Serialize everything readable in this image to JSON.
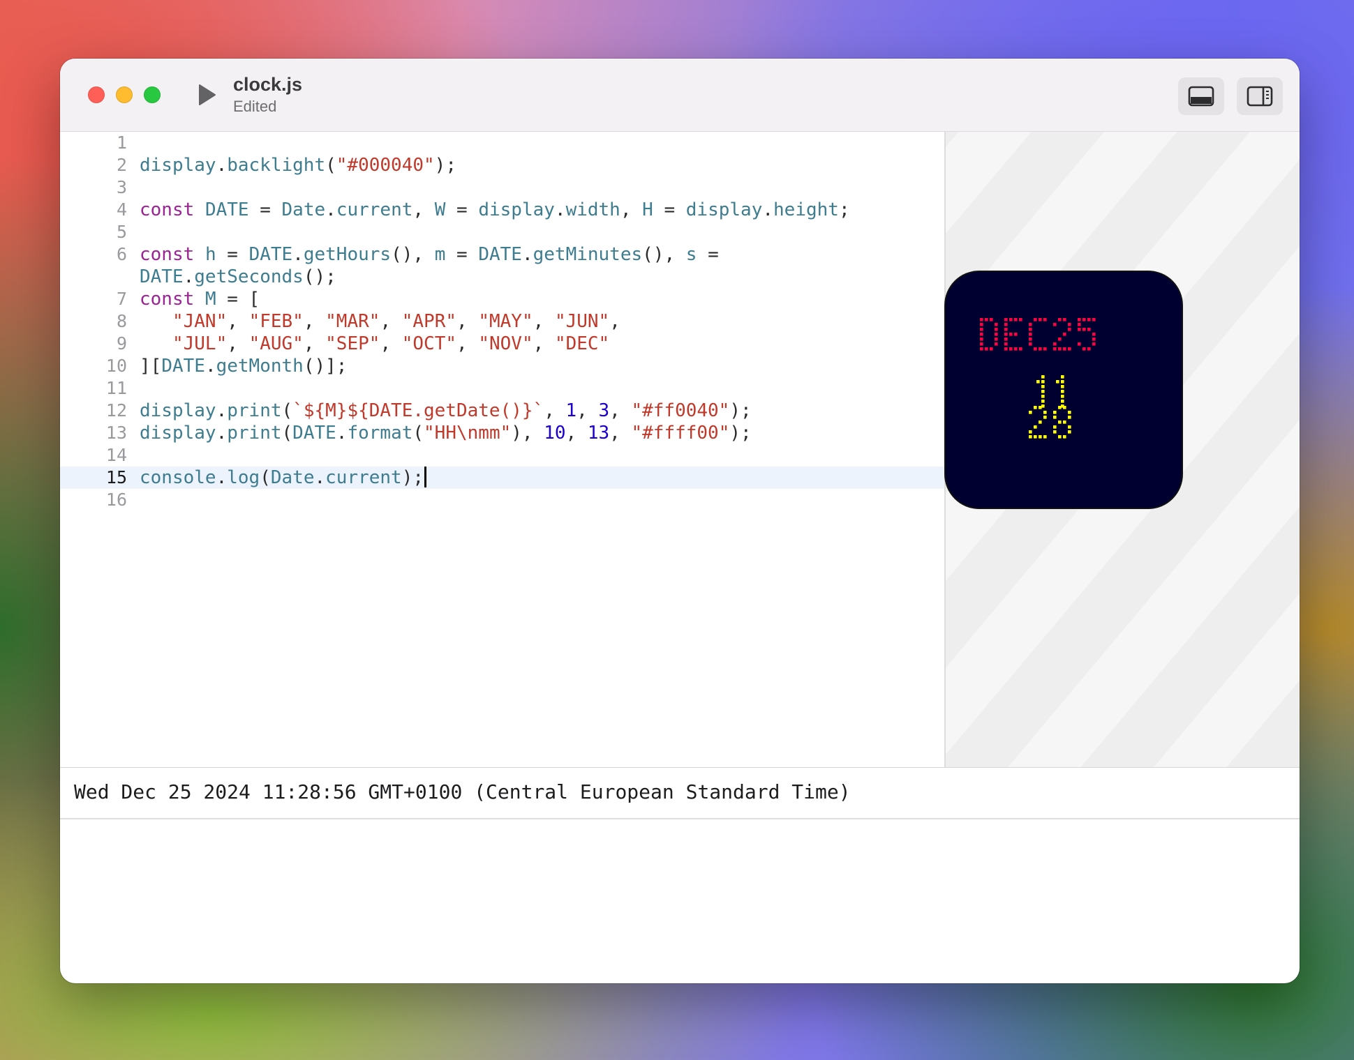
{
  "window": {
    "title": "clock.js",
    "subtitle": "Edited",
    "run_icon": "play-icon",
    "toggle_bottom_icon": "bottom-panel-icon",
    "toggle_side_icon": "sidebar-right-icon"
  },
  "editor": {
    "active_line": 15,
    "lines": [
      {
        "n": "1",
        "code": ""
      },
      {
        "n": "2",
        "code": "display.backlight(\"#000040\");"
      },
      {
        "n": "3",
        "code": ""
      },
      {
        "n": "4",
        "code": "const DATE = Date.current, W = display.width, H = display.height;"
      },
      {
        "n": "5",
        "code": ""
      },
      {
        "n": "6",
        "code": "const h = DATE.getHours(), m = DATE.getMinutes(), s ="
      },
      {
        "n": "",
        "code": "DATE.getSeconds();"
      },
      {
        "n": "7",
        "code": "const M = ["
      },
      {
        "n": "8",
        "code": "   \"JAN\", \"FEB\", \"MAR\", \"APR\", \"MAY\", \"JUN\","
      },
      {
        "n": "9",
        "code": "   \"JUL\", \"AUG\", \"SEP\", \"OCT\", \"NOV\", \"DEC\""
      },
      {
        "n": "10",
        "code": "][DATE.getMonth()];"
      },
      {
        "n": "11",
        "code": ""
      },
      {
        "n": "12",
        "code": "display.print(`${M}${DATE.getDate()}`, 1, 3, \"#ff0040\");"
      },
      {
        "n": "13",
        "code": "display.print(DATE.format(\"HH\\nmm\"), 10, 13, \"#ffff00\");"
      },
      {
        "n": "14",
        "code": ""
      },
      {
        "n": "15",
        "code": "console.log(Date.current);"
      },
      {
        "n": "16",
        "code": ""
      }
    ]
  },
  "preview": {
    "backlight": "#000030",
    "line1": "DEC25",
    "line1_color": "#ff0040",
    "line2": "11",
    "line3": "28",
    "time_color": "#ffff00"
  },
  "console": {
    "output": "Wed Dec 25 2024 11:28:56 GMT+0100 (Central European Standard Time)"
  },
  "colors": {
    "keyword": "#9b2393",
    "identifier": "#3e7c8f",
    "string": "#c0392b",
    "number": "#1c00cf"
  }
}
